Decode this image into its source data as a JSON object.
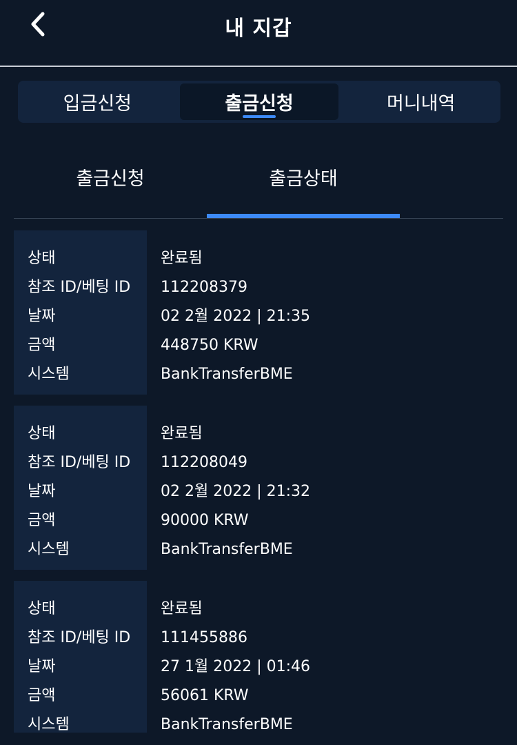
{
  "header": {
    "title": "내 지갑",
    "back_icon": "chevron-left-icon"
  },
  "main_tabs": [
    {
      "label": "입금신청",
      "active": false
    },
    {
      "label": "출금신청",
      "active": true
    },
    {
      "label": "머니내역",
      "active": false
    }
  ],
  "sub_tabs": [
    {
      "label": "출금신청",
      "active": false
    },
    {
      "label": "출금상태",
      "active": true
    }
  ],
  "field_labels": {
    "status": "상태",
    "reference": "참조 ID/베팅 ID",
    "date": "날짜",
    "amount": "금액",
    "system": "시스템"
  },
  "records": [
    {
      "status": "완료됨",
      "reference": "112208379",
      "date": "02 2월 2022 | 21:35",
      "amount": "448750 KRW",
      "system": "BankTransferBME"
    },
    {
      "status": "완료됨",
      "reference": "112208049",
      "date": "02 2월 2022 | 21:32",
      "amount": "90000 KRW",
      "system": "BankTransferBME"
    },
    {
      "status": "완료됨",
      "reference": "111455886",
      "date": "27 1월 2022 | 01:46",
      "amount": "56061 KRW",
      "system": "BankTransferBME"
    }
  ],
  "colors": {
    "background": "#0d1828",
    "panel": "#13243d",
    "accent": "#3d8af7"
  }
}
